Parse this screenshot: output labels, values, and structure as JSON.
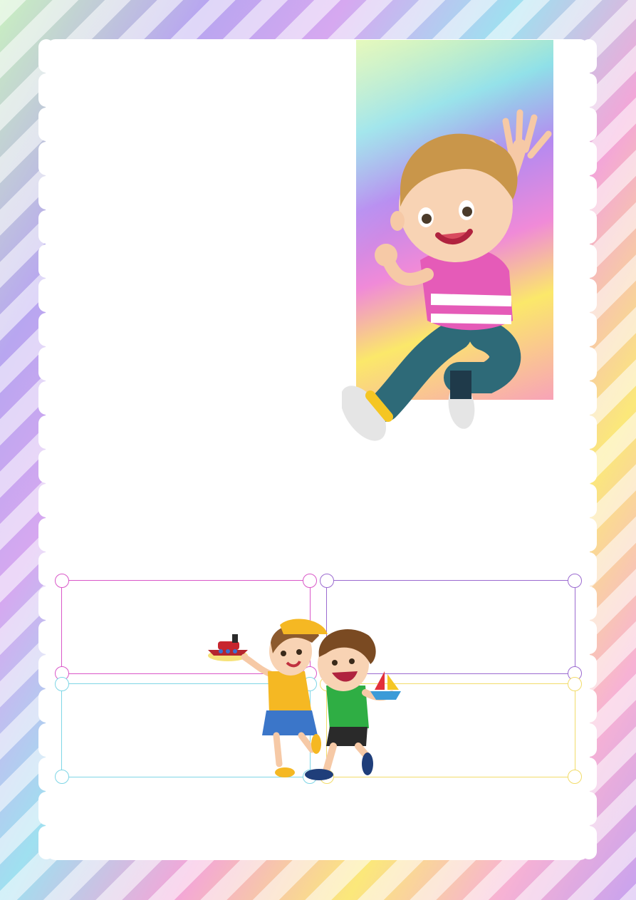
{
  "page": {
    "background": {
      "style": "diagonal-pastel-rainbow-stripes",
      "colors": [
        "#c9f0c0",
        "#b8a6f0",
        "#9fe0f0",
        "#f3a6d8",
        "#fbe87a",
        "#f7b2d4"
      ]
    },
    "paper": {
      "color": "#ffffff",
      "edge": "scalloped"
    },
    "rainbow_panel": {
      "colors": [
        "#d8f59a",
        "#8ee0e8",
        "#b58af0",
        "#f08ad8",
        "#fbe86a",
        "#f8a3b8"
      ]
    },
    "illustrations": [
      {
        "name": "jumping-boy-waving",
        "shirt_color": "#e55bb8",
        "pants_color": "#2e6a78",
        "hair_color": "#c9964a"
      },
      {
        "name": "children-with-toy-boats",
        "girl_shirt": "#f5b823",
        "girl_skirt": "#3b76c9",
        "boy_shirt": "#2fae44"
      }
    ],
    "text_boxes": [
      {
        "name": "pink-frame",
        "border_color": "#d957c8",
        "text": ""
      },
      {
        "name": "purple-frame",
        "border_color": "#9b6ad0",
        "text": ""
      },
      {
        "name": "cyan-frame",
        "border_color": "#7fd6e6",
        "text": ""
      },
      {
        "name": "yellow-frame",
        "border_color": "#f2dc6a",
        "text": ""
      }
    ]
  }
}
